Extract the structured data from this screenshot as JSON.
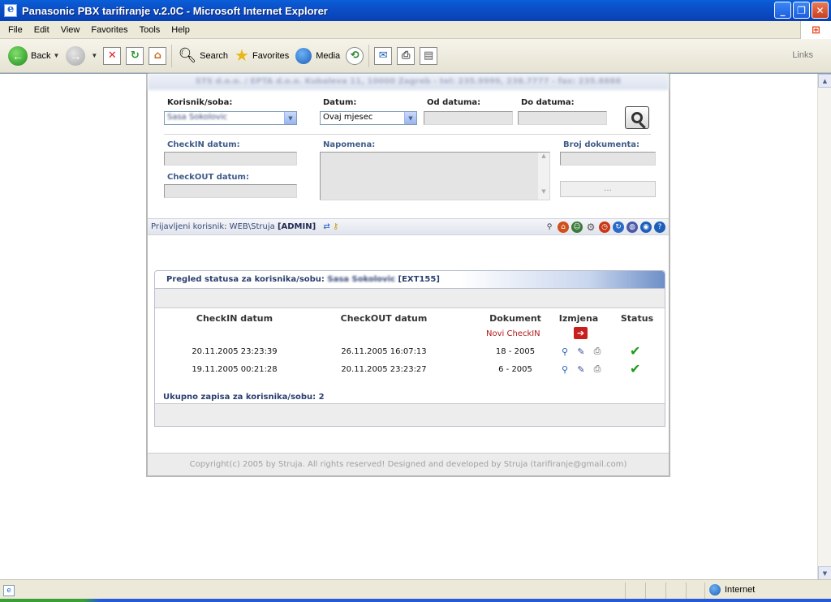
{
  "window": {
    "title": "Panasonic PBX tarifiranje v.2.0C - Microsoft Internet Explorer"
  },
  "menu": [
    "File",
    "Edit",
    "View",
    "Favorites",
    "Tools",
    "Help"
  ],
  "toolbar": {
    "back": "Back",
    "search": "Search",
    "favorites": "Favorites",
    "media": "Media",
    "links": "Links"
  },
  "header": {
    "company": "STS d.o.o. / EPTA d.o.o. Kubaleva 11, 10000 Zagreb - tel: 235.9999, 238.7777 - fax: 235.8888"
  },
  "filters": {
    "user_label": "Korisnik/soba:",
    "user_value": "Sasa Sokolovic",
    "date_label": "Datum:",
    "date_value": "Ovaj mjesec",
    "from_label": "Od datuma:",
    "to_label": "Do datuma:"
  },
  "form": {
    "checkin_label": "CheckIN datum:",
    "checkout_label": "CheckOUT datum:",
    "note_label": "Napomena:",
    "doc_label": "Broj dokumenta:",
    "dots_label": "..."
  },
  "userbar": {
    "prefix": "Prijavljeni korisnik: WEB\\Struja",
    "role": "[ADMIN]"
  },
  "panel": {
    "title_prefix": "Pregled statusa za korisnika/sobu:",
    "title_user": "Sasa Sokolovic",
    "title_ext": "[EXT155]",
    "columns": [
      "CheckIN datum",
      "CheckOUT datum",
      "Dokument",
      "Izmjena",
      "Status"
    ],
    "new_checkin": "Novi CheckIN",
    "rows": [
      {
        "checkin": "20.11.2005 23:23:39",
        "checkout": "26.11.2005 16:07:13",
        "doc": "18 - 2005"
      },
      {
        "checkin": "19.11.2005 00:21:28",
        "checkout": "20.11.2005 23:23:27",
        "doc": "6 - 2005"
      }
    ],
    "total": "Ukupno zapisa za korisnika/sobu: 2"
  },
  "footer": "Copyright(c) 2005 by Struja. All rights reserved! Designed and developed by Struja (tarifiranje@gmail.com)",
  "status": {
    "zone": "Internet"
  }
}
